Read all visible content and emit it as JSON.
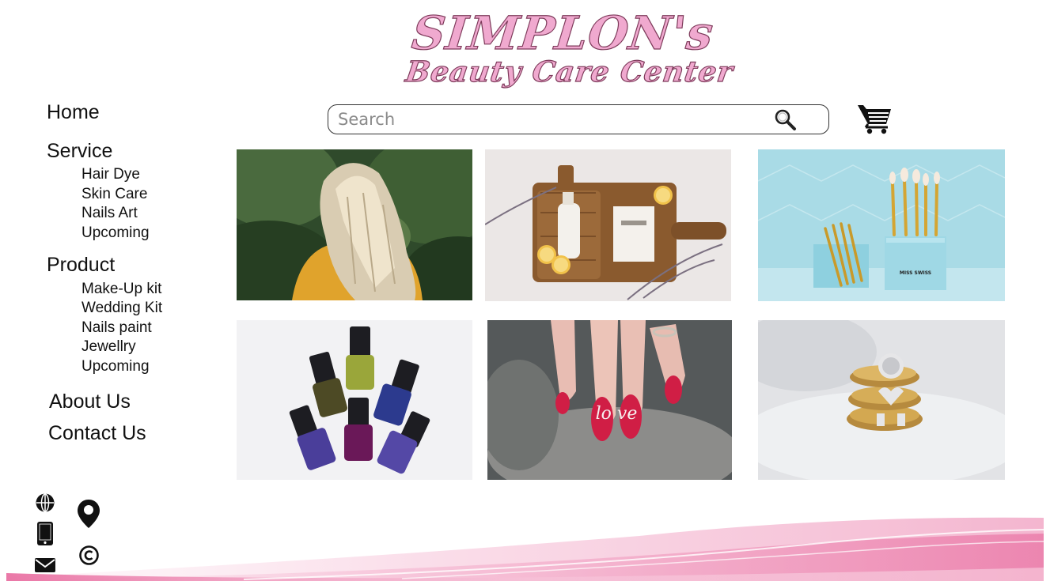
{
  "brand": {
    "line1": "SIMPLON's",
    "line2": "Beauty Care Center",
    "color": "#f0a9cf"
  },
  "nav": {
    "home": "Home",
    "service": {
      "label": "Service",
      "items": [
        "Hair Dye",
        "Skin Care",
        "Nails Art",
        "Upcoming"
      ]
    },
    "product": {
      "label": "Product",
      "items": [
        "Make-Up kit",
        "Wedding Kit",
        "Nails paint",
        "Jewellry",
        "Upcoming"
      ]
    },
    "about": "About Us",
    "contact": "Contact Us"
  },
  "search": {
    "placeholder": "Search",
    "value": ""
  },
  "icons": {
    "search": "search-icon",
    "cart": "cart-icon",
    "footer": [
      "globe-icon",
      "location-pin-icon",
      "mobile-phone-icon",
      "mail-icon",
      "copyright-icon"
    ]
  },
  "gallery": [
    {
      "name": "blonde-hair-photo"
    },
    {
      "name": "skincare-board-photo"
    },
    {
      "name": "makeup-brush-set-photo"
    },
    {
      "name": "nail-polish-bottles-photo"
    },
    {
      "name": "love-nail-art-photo"
    },
    {
      "name": "gold-rings-photo"
    }
  ],
  "gallery_labels": {
    "brush_box": "MISS SWISS",
    "nail_letters": "lo ve"
  },
  "accent_colors": {
    "pink": "#e86a9e",
    "light_pink": "#f6c2d8"
  }
}
